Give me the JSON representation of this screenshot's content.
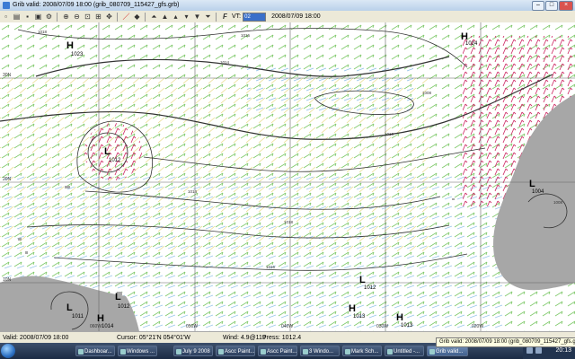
{
  "window": {
    "title": "Grib valid: 2008/07/09 18:00  (grib_080709_115427_gfs.grb)",
    "buttons": [
      "minimize-icon",
      "maximize-icon",
      "close-icon"
    ]
  },
  "toolbar": {
    "vt_label": "VT:",
    "vt_value": "02",
    "vt_time": "2008/07/09 18:00"
  },
  "map": {
    "pressure_systems": [
      {
        "type": "H",
        "value": "1023"
      },
      {
        "type": "H",
        "value": "1024"
      },
      {
        "type": "L",
        "value": "1012"
      },
      {
        "type": "L",
        "value": "1004"
      },
      {
        "type": "L",
        "value": "1012"
      },
      {
        "type": "H",
        "value": "1013"
      },
      {
        "type": "H",
        "value": "1013"
      },
      {
        "type": "L",
        "value": "1011"
      },
      {
        "type": "H",
        "value": "1014"
      },
      {
        "type": "L",
        "value": "1012"
      }
    ],
    "lat_labels": [
      "30N",
      "20N",
      "10N"
    ],
    "lon_labels": [
      "060W",
      "050W",
      "040W",
      "030W",
      "020W"
    ],
    "isobar_labels": [
      "1018",
      "1016",
      "1014",
      "1016",
      "1014",
      "1018",
      "1008",
      "1016",
      "1008"
    ]
  },
  "status": {
    "valid": "Valid: 2008/07/09 18:00",
    "cursor": "Cursor: 05°21'N  054°01'W",
    "wind": "Wind:  4.9@119",
    "press": "Press: 1012.4"
  },
  "tooltip": "Grib valid: 2008/07/09 18:00  (grib_080709_115427_gfs.grb)",
  "taskbar": {
    "tasks": [
      "Dashboar...",
      "Windows ...",
      "July 9 2008",
      "Ascc Paint...",
      "Ascc Paint...",
      "3 Windo...",
      "Mark Sch...",
      "Untitled -...",
      "Grib valid..."
    ],
    "clock": "20:13"
  }
}
